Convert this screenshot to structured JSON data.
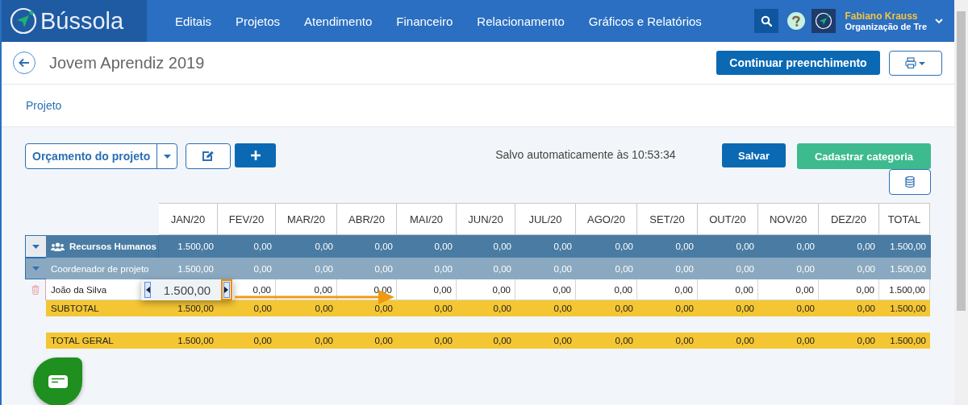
{
  "brand": {
    "name": "Bússola"
  },
  "nav": [
    {
      "label": "Editais"
    },
    {
      "label": "Projetos"
    },
    {
      "label": "Atendimento"
    },
    {
      "label": "Financeiro"
    },
    {
      "label": "Relacionamento"
    },
    {
      "label": "Gráficos e Relatórios"
    }
  ],
  "user": {
    "name": "Fabiano Krauss",
    "organization": "Organização de Tre"
  },
  "page": {
    "title": "Jovem Aprendiz 2019",
    "primary_action": "Continuar preenchimento"
  },
  "breadcrumb": [
    {
      "label": "Projeto"
    }
  ],
  "toolbar": {
    "budget_select": "Orçamento do projeto",
    "autosave": "Salvo automaticamente às 10:53:34",
    "save": "Salvar",
    "add_category": "Cadastrar categoria"
  },
  "table": {
    "columns": [
      "JAN/20",
      "FEV/20",
      "MAR/20",
      "ABR/20",
      "MAI/20",
      "JUN/20",
      "JUL/20",
      "AGO/20",
      "SET/20",
      "OUT/20",
      "NOV/20",
      "DEZ/20",
      "TOTAL"
    ],
    "rows": [
      {
        "kind": "category",
        "label": "Recursos Humanos",
        "expanded": true,
        "values": [
          "1.500,00",
          "0,00",
          "0,00",
          "0,00",
          "0,00",
          "0,00",
          "0,00",
          "0,00",
          "0,00",
          "0,00",
          "0,00",
          "0,00",
          "1.500,00"
        ]
      },
      {
        "kind": "subcategory",
        "label": "Coordenador de projeto",
        "expanded": true,
        "values": [
          "1.500,00",
          "0,00",
          "0,00",
          "0,00",
          "0,00",
          "0,00",
          "0,00",
          "0,00",
          "0,00",
          "0,00",
          "0,00",
          "0,00",
          "1.500,00"
        ]
      },
      {
        "kind": "item",
        "label": "João da Silva",
        "values": [
          "0,00",
          "0,00",
          "0,00",
          "0,00",
          "0,00",
          "0,00",
          "0,00",
          "0,00",
          "0,00",
          "0,00",
          "0,00",
          "1.500,00"
        ]
      },
      {
        "kind": "subtotal",
        "label": "SUBTOTAL",
        "values": [
          "1.500,00",
          "0,00",
          "0,00",
          "0,00",
          "0,00",
          "0,00",
          "0,00",
          "0,00",
          "0,00",
          "0,00",
          "0,00",
          "0,00",
          "1.500,00"
        ]
      },
      {
        "kind": "total",
        "label": "TOTAL GERAL",
        "values": [
          "1.500,00",
          "0,00",
          "0,00",
          "0,00",
          "0,00",
          "0,00",
          "0,00",
          "0,00",
          "0,00",
          "0,00",
          "0,00",
          "0,00",
          "1.500,00"
        ]
      }
    ]
  },
  "callout": {
    "value": "1.500,00"
  }
}
